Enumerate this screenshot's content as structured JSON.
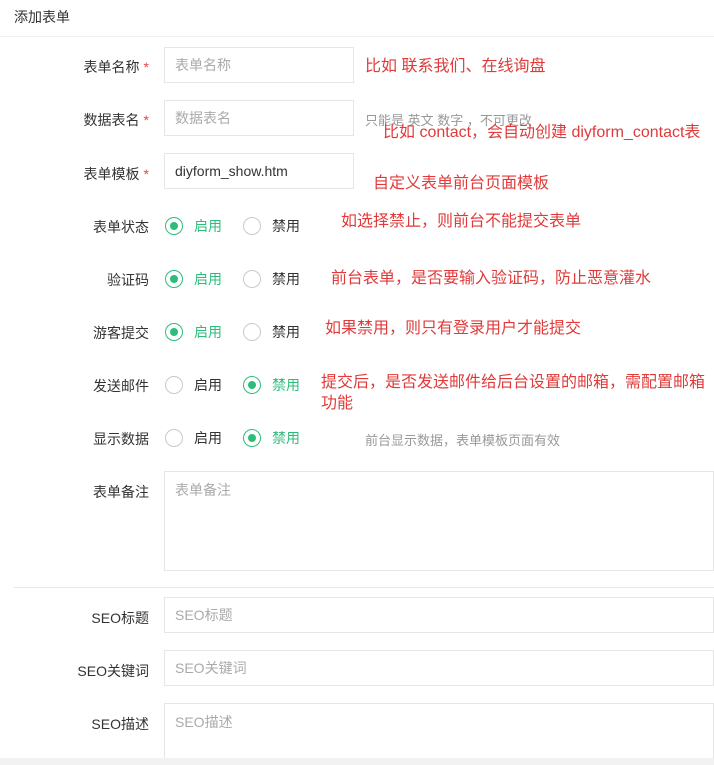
{
  "header": {
    "title": "添加表单"
  },
  "fields": {
    "form_name": {
      "label": "表单名称",
      "required": "*",
      "placeholder": "表单名称"
    },
    "table_name": {
      "label": "数据表名",
      "required": "*",
      "placeholder": "数据表名",
      "hint": "只能是 英文 数字 ，不可更改"
    },
    "template": {
      "label": "表单模板",
      "required": "*",
      "value": "diyform_show.htm"
    },
    "status": {
      "label": "表单状态",
      "enable": "启用",
      "disable": "禁用",
      "selected": "启用"
    },
    "captcha": {
      "label": "验证码",
      "enable": "启用",
      "disable": "禁用",
      "selected": "启用"
    },
    "guest_submit": {
      "label": "游客提交",
      "enable": "启用",
      "disable": "禁用",
      "selected": "启用"
    },
    "send_mail": {
      "label": "发送邮件",
      "enable": "启用",
      "disable": "禁用",
      "selected": "禁用"
    },
    "show_data": {
      "label": "显示数据",
      "enable": "启用",
      "disable": "禁用",
      "selected": "禁用",
      "hint": "前台显示数据，表单模板页面有效"
    },
    "remark": {
      "label": "表单备注",
      "placeholder": "表单备注"
    },
    "seo_title": {
      "label": "SEO标题",
      "placeholder": "SEO标题"
    },
    "seo_keywords": {
      "label": "SEO关键词",
      "placeholder": "SEO关键词"
    },
    "seo_description": {
      "label": "SEO描述",
      "placeholder": "SEO描述"
    }
  },
  "annotations": {
    "form_name": "比如 联系我们、在线询盘",
    "table_name": "比如 contact，会自动创建 diyform_contact表",
    "template": "自定义表单前台页面模板",
    "status": "如选择禁止，则前台不能提交表单",
    "captcha": "前台表单，是否要输入验证码，防止恶意灌水",
    "guest_submit": "如果禁用，则只有登录用户才能提交",
    "send_mail": "提交后，是否发送邮件给后台设置的邮箱，需配置邮箱功能"
  },
  "colors": {
    "accent": "#2dbd7b",
    "annotation": "#e03a3a",
    "required": "#e54545"
  }
}
